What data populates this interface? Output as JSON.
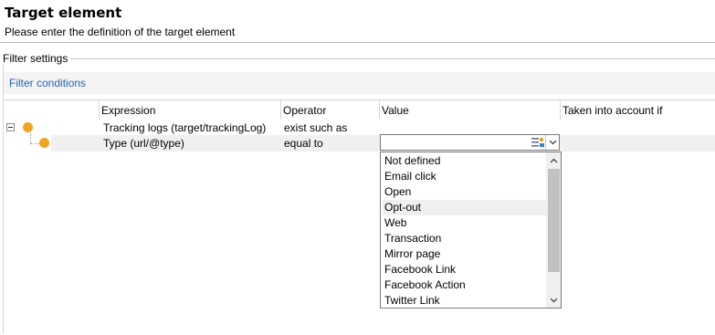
{
  "header": {
    "title": "Target element",
    "subtitle": "Please enter the definition of the target element"
  },
  "filter_settings": {
    "legend": "Filter settings",
    "conditions_title": "Filter conditions"
  },
  "columns": [
    "Expression",
    "Operator",
    "Value",
    "Taken into account if"
  ],
  "rows": [
    {
      "expression": "Tracking logs (target/trackingLog)",
      "operator": "exist such as"
    },
    {
      "expression": "Type (url/@type)",
      "operator": "equal to",
      "value": ""
    }
  ],
  "dropdown": {
    "options": [
      "Not defined",
      "Email click",
      "Open",
      "Opt-out",
      "Web",
      "Transaction",
      "Mirror page",
      "Facebook Link",
      "Facebook Action",
      "Twitter Link"
    ],
    "highlighted": "Opt-out"
  },
  "colors": {
    "accent": "#2563b8",
    "node": "#f0a51e"
  },
  "icons": [
    "collapse-icon",
    "condition-node-icon",
    "value-editor-icon",
    "chevron-down-icon",
    "scroll-up-icon",
    "scroll-down-icon"
  ]
}
